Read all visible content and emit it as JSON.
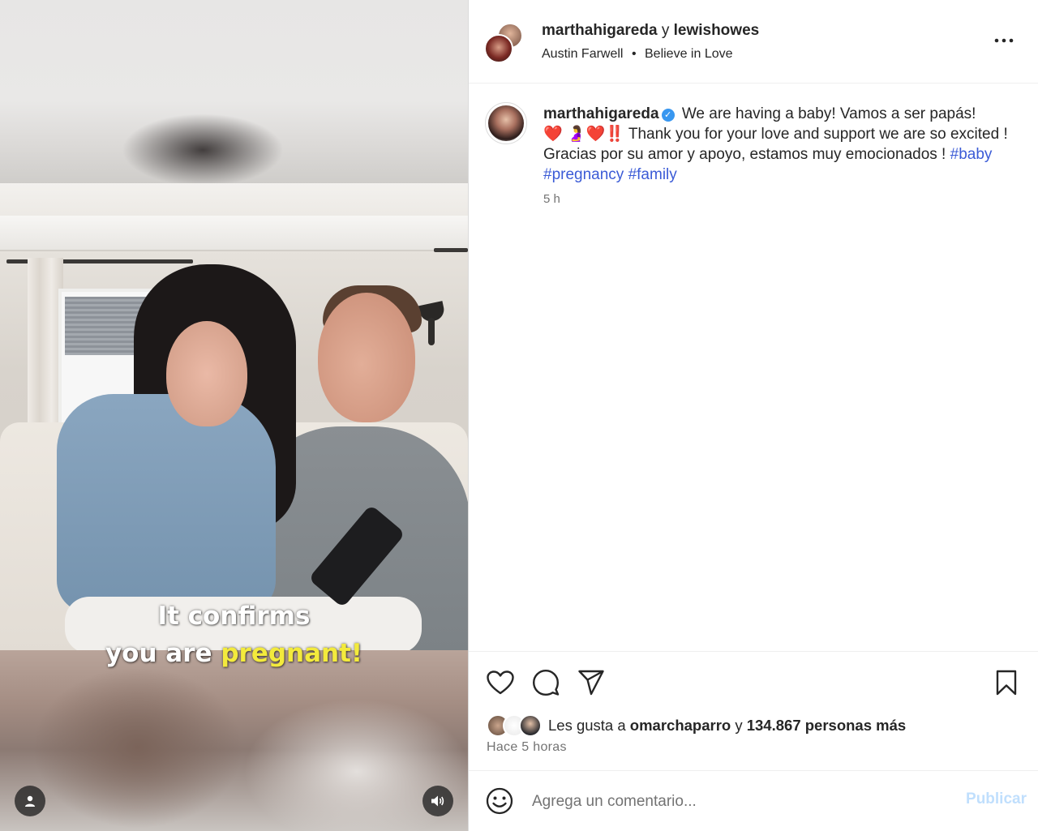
{
  "post_header": {
    "author1": "marthahigareda",
    "joiner": "y",
    "author2": "lewishowes",
    "audio_artist": "Austin Farwell",
    "separator": "•",
    "audio_title": "Believe in Love",
    "more_label": "•••"
  },
  "video": {
    "caption_line1": "It confirms",
    "caption_line2_pre": "you are",
    "caption_line2_highlight": "pregnant!",
    "highlight_color": "#f3ea3c"
  },
  "caption_comment": {
    "username": "marthahigareda",
    "verified_mark": "✓",
    "text_line_a": "We are having a baby! Vamos a ser papás!",
    "emojis": "❤️ 🤰❤️‼️",
    "text_line_b": "Thank you for your love and support we are so excited ! Gracias por su amor y apoyo, estamos muy emocionados !",
    "hashtags": [
      "#baby",
      "#pregnancy",
      "#family"
    ],
    "time": "5 h"
  },
  "actions": {
    "like_icon": "heart-icon",
    "comment_icon": "comment-icon",
    "share_icon": "share-icon",
    "save_icon": "bookmark-icon"
  },
  "likes": {
    "prefix": "Les gusta a",
    "first_user": "omarchaparro",
    "joiner": "y",
    "others": "134.867 personas más",
    "posted_ago": "Hace 5 horas"
  },
  "comment_box": {
    "placeholder": "Agrega un comentario...",
    "publish_label": "Publicar",
    "emoji_icon": "emoji-icon"
  },
  "colors": {
    "link": "#3b5bd6",
    "verified": "#3897f0",
    "publish_disabled": "#c0dffd",
    "muted": "#737373"
  }
}
